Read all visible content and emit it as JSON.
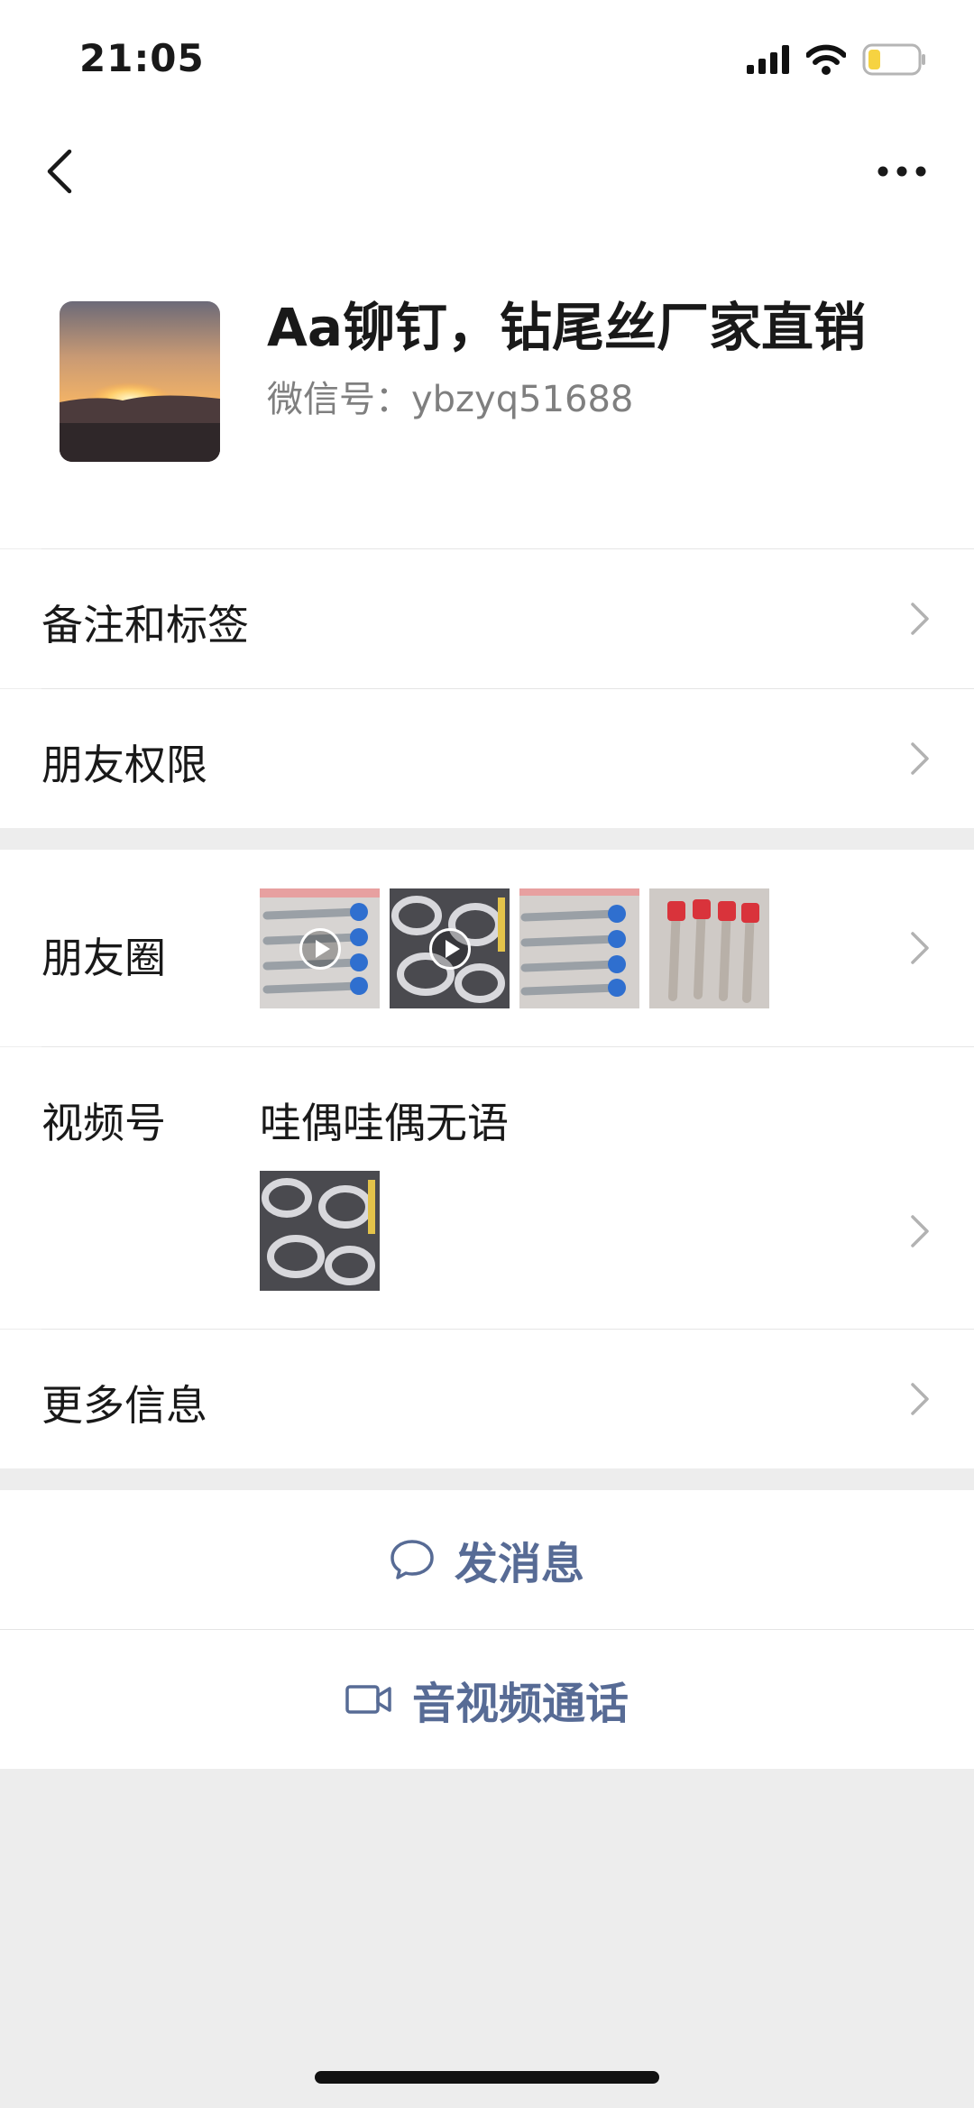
{
  "status_bar": {
    "time": "21:05",
    "icons": [
      "signal-icon",
      "wifi-icon",
      "battery-icon"
    ],
    "battery_color": "#f6d341"
  },
  "nav": {
    "back_icon": "chevron-left-icon",
    "more_icon": "more-dots-icon"
  },
  "profile": {
    "name": "Aa铆钉，钻尾丝厂家直销",
    "wechat_id": "微信号：ybzyq51688"
  },
  "rows": {
    "remark_tags": "备注和标签",
    "friend_permissions": "朋友权限",
    "moments": "朋友圈",
    "channels": "视频号",
    "channels_name": "哇偶哇偶无语",
    "more_info": "更多信息"
  },
  "actions": {
    "message": "发消息",
    "message_icon": "chat-bubble-icon",
    "call": "音视频通话",
    "call_icon": "video-camera-icon"
  },
  "colors": {
    "accent": "#576b95",
    "background": "#ededed",
    "surface": "#ffffff"
  }
}
